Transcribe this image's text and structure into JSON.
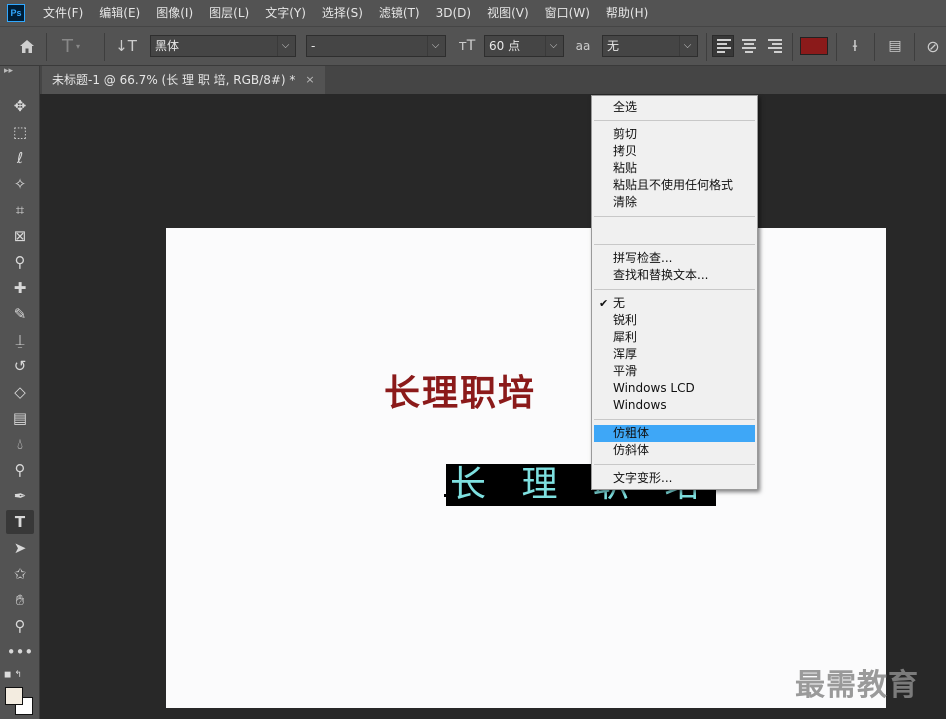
{
  "app": {
    "logo": "Ps"
  },
  "menu": [
    "文件(F)",
    "编辑(E)",
    "图像(I)",
    "图层(L)",
    "文字(Y)",
    "选择(S)",
    "滤镜(T)",
    "3D(D)",
    "视图(V)",
    "窗口(W)",
    "帮助(H)"
  ],
  "options": {
    "font_family": "黑体",
    "font_style": "-",
    "font_size": "60 点",
    "aa_label": "aa",
    "antialias": "无",
    "text_color": "#8b1a1a"
  },
  "document": {
    "tab_title": "未标题-1 @ 66.7% (长 理 职 培, RGB/8#) *",
    "close": "×"
  },
  "canvas": {
    "red_text": "长理职培",
    "selected_text": "长 理 职 培"
  },
  "context_menu": {
    "select_all": "全选",
    "edit": [
      "剪切",
      "拷贝",
      "粘贴",
      "粘贴且不使用任何格式",
      "清除"
    ],
    "tools": [
      "拼写检查...",
      "查找和替换文本..."
    ],
    "antialias": [
      "无",
      "锐利",
      "犀利",
      "浑厚",
      "平滑",
      "Windows LCD",
      "Windows"
    ],
    "checked_mark": "✔",
    "faux": [
      "仿粗体",
      "仿斜体"
    ],
    "warp": "文字变形..."
  },
  "watermark": "最需教育",
  "icons": {
    "home": "home-icon",
    "type_tool": "type-icon",
    "orientation": "text-orientation-icon"
  }
}
